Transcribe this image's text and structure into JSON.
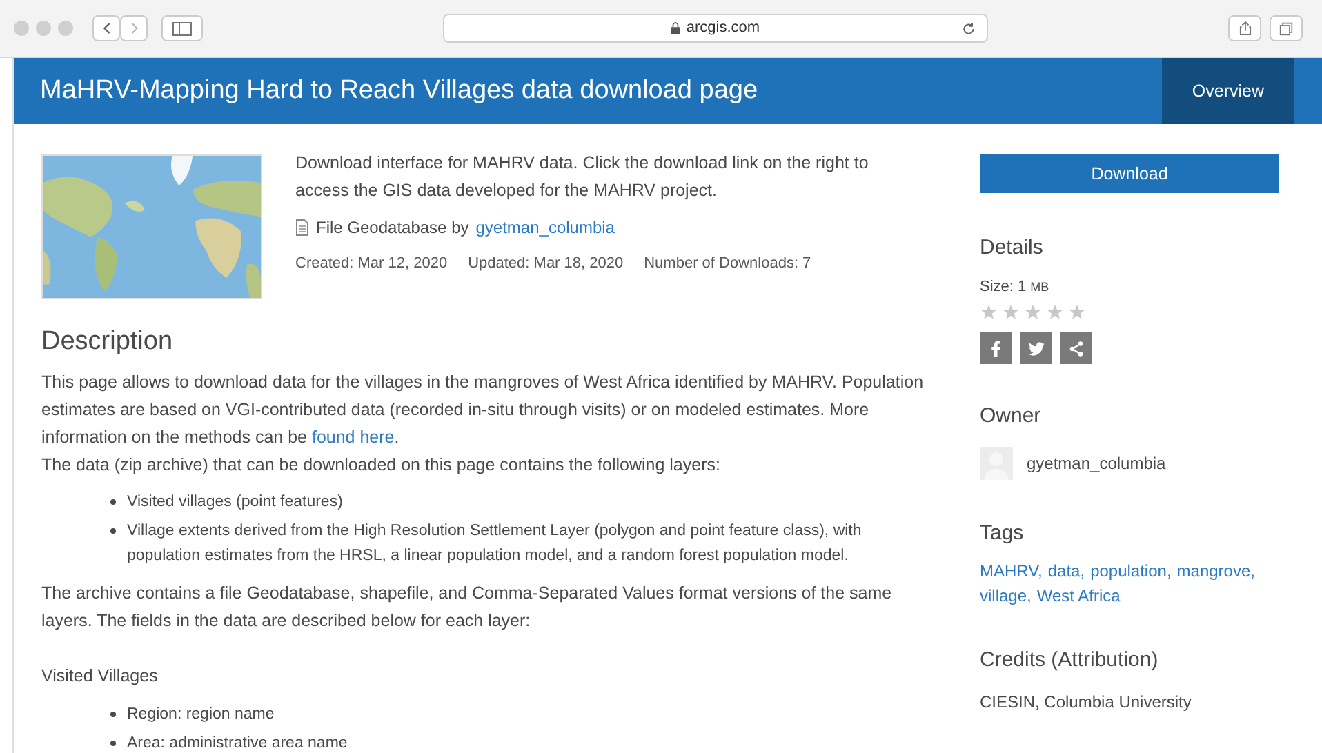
{
  "browser": {
    "address": "arcgis.com"
  },
  "header": {
    "title": "MaHRV-Mapping Hard to Reach Villages data download page",
    "tabs": [
      {
        "label": "Overview",
        "selected": true
      }
    ]
  },
  "summary": {
    "text": "Download interface for MAHRV data. Click the download link on the right to access the GIS data developed for the MAHRV project.",
    "type_label": "File Geodatabase by",
    "owner_link": "gyetman_columbia",
    "meta": [
      "Created: Mar 12, 2020",
      "Updated: Mar 18, 2020",
      "Number of Downloads: 7"
    ]
  },
  "description": {
    "heading": "Description",
    "intro": {
      "before": "This page allows to download data for the villages in the mangroves of West Africa identified by MAHRV. Population estimates are based on VGI-contributed data (recorded in-situ through visits) or on modeled estimates. More information on the methods can be ",
      "link": "found here",
      "after": "."
    },
    "layers_intro": "The data (zip archive) that can be downloaded on this page contains the following layers:",
    "layers": [
      "Visited villages (point features)",
      "Village extents derived from the High Resolution Settlement Layer (polygon and point feature class), with population estimates from the HRSL, a linear population model, and a random forest population model."
    ],
    "archive_text": "The archive contains a file Geodatabase, shapefile, and Comma-Separated Values format versions of the same layers. The fields in the data are described below for each layer:",
    "subheading": "Visited Villages",
    "fields": [
      "Region: region name",
      "Area: administrative area name"
    ]
  },
  "sidebar": {
    "download": "Download",
    "details_heading": "Details",
    "size_label": "Size: 1",
    "size_unit": "MB",
    "stars": 0,
    "share": [
      {
        "kind": "facebook"
      },
      {
        "kind": "twitter"
      },
      {
        "kind": "share"
      }
    ],
    "owner_heading": "Owner",
    "owner": "gyetman_columbia",
    "tags_heading": "Tags",
    "tags": [
      "MAHRV,",
      "data,",
      "population,",
      "mangrove,",
      "village,",
      "West Africa"
    ],
    "credits_heading": "Credits (Attribution)",
    "credits": "CIESIN, Columbia University"
  }
}
